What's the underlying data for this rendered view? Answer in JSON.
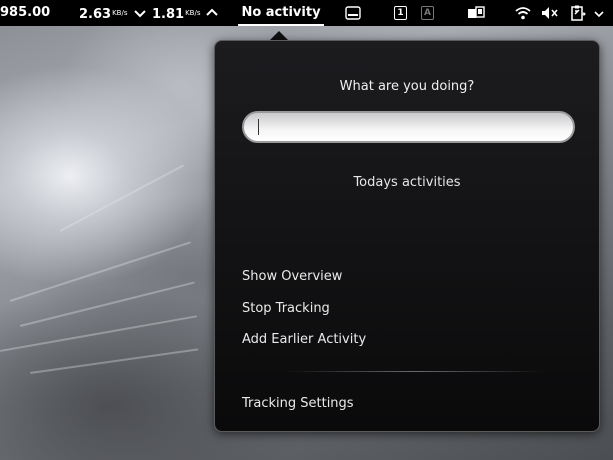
{
  "panel": {
    "stock_value": "985.00",
    "net_down": "2.63",
    "net_down_unit": "KB/s",
    "net_up": "1.81",
    "net_up_unit": "KB/s",
    "activity_title": "No activity",
    "workspace_1": "1",
    "workspace_a": "A",
    "icons": [
      "down-arrow-icon",
      "up-arrow-icon",
      "keyboard-icon",
      "display-icon",
      "wifi-icon",
      "volume-muted-icon",
      "clipboard-icon"
    ]
  },
  "popup": {
    "heading": "What are you doing?",
    "search_value": "",
    "subheading": "Todays activities",
    "menu": [
      {
        "label": "Show Overview"
      },
      {
        "label": "Stop Tracking"
      },
      {
        "label": "Add Earlier Activity"
      }
    ],
    "settings_label": "Tracking Settings"
  }
}
